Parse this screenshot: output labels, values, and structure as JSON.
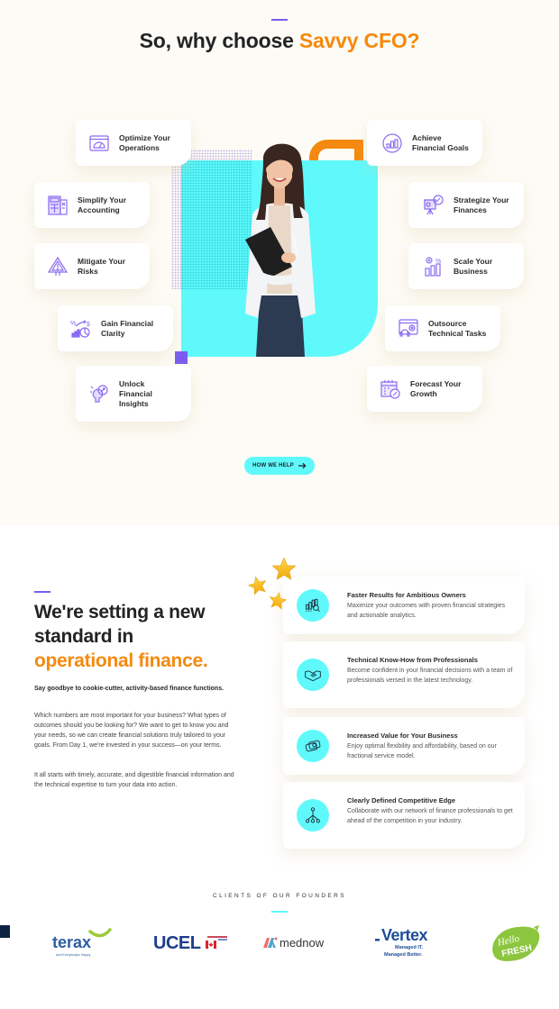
{
  "why_section": {
    "title_prefix": "So, why choose ",
    "title_highlight": "Savvy CFO?",
    "features_left": [
      {
        "label": "Optimize Your\nOperations",
        "icon": "dashboard-gauge-icon"
      },
      {
        "label": "Simplify Your\nAccounting",
        "icon": "calculator-icon"
      },
      {
        "label": "Mitigate Your\nRisks",
        "icon": "warning-sign-icon"
      },
      {
        "label": "Gain Financial\nClarity",
        "icon": "finance-chart-icon"
      },
      {
        "label": "Unlock\nFinancial\nInsights",
        "icon": "lightbulb-icon"
      }
    ],
    "features_right": [
      {
        "label": "Achieve\nFinancial Goals",
        "icon": "target-chart-icon"
      },
      {
        "label": "Strategize Your\nFinances",
        "icon": "presentation-board-icon"
      },
      {
        "label": "Scale Your\nBusiness",
        "icon": "growth-bars-icon"
      },
      {
        "label": "Outsource\nTechnical Tasks",
        "icon": "support-headset-icon"
      },
      {
        "label": "Forecast Your\nGrowth",
        "icon": "calendar-chart-icon"
      }
    ],
    "cta_label": "HOW WE HELP",
    "cta_icon": "arrow-right-icon"
  },
  "standard_section": {
    "title_line1": "We're setting a new",
    "title_line2": "standard in",
    "title_highlight": "operational finance.",
    "lead": "Say goodbye to cookie-cutter, activity-based finance functions.",
    "paragraph1": "Which numbers are most important for your business? What types of outcomes should you be looking for? We want to get to know you and your needs, so we can create financial solutions truly tailored to your goals. From Day 1, we're invested in your success—on your terms.",
    "paragraph2": "It all starts with timely, accurate, and digestible financial information and the technical expertise to turn your data into action.",
    "value_cards": [
      {
        "title": "Faster Results for Ambitious Owners",
        "desc": "Maximize your outcomes with proven financial strategies and actionable analytics.",
        "icon": "analytics-search-icon"
      },
      {
        "title": "Technical Know-How from Professionals",
        "desc": "Become confident in your financial decisions with a team of professionals versed in the latest technology.",
        "icon": "handshake-icon"
      },
      {
        "title": "Increased Value for Your Business",
        "desc": "Enjoy optimal flexibility and affordability, based on our fractional service model.",
        "icon": "money-stack-icon"
      },
      {
        "title": "Clearly Defined Competitive Edge",
        "desc": "Collaborate with our network of finance professionals to get ahead of the competition in your industry.",
        "icon": "network-icon"
      }
    ]
  },
  "clients": {
    "title": "CLIENTS OF OUR FOUNDERS",
    "logos": [
      {
        "name": "terax",
        "text": "terax",
        "tagline": "And Everybody's Happy"
      },
      {
        "name": "ucel",
        "text": "UCEL"
      },
      {
        "name": "mednow",
        "text": "mednow"
      },
      {
        "name": "vertex",
        "text": "Vertex",
        "tagline1": "Managed IT.",
        "tagline2": "Managed Better."
      },
      {
        "name": "hellofresh",
        "text1": "Hello",
        "text2": "FRESH"
      }
    ]
  },
  "colors": {
    "accent_orange": "#f5890f",
    "accent_cyan": "#5ff9fb",
    "accent_purple": "#7b5cf0",
    "cream_bg": "#fdfbf5"
  }
}
